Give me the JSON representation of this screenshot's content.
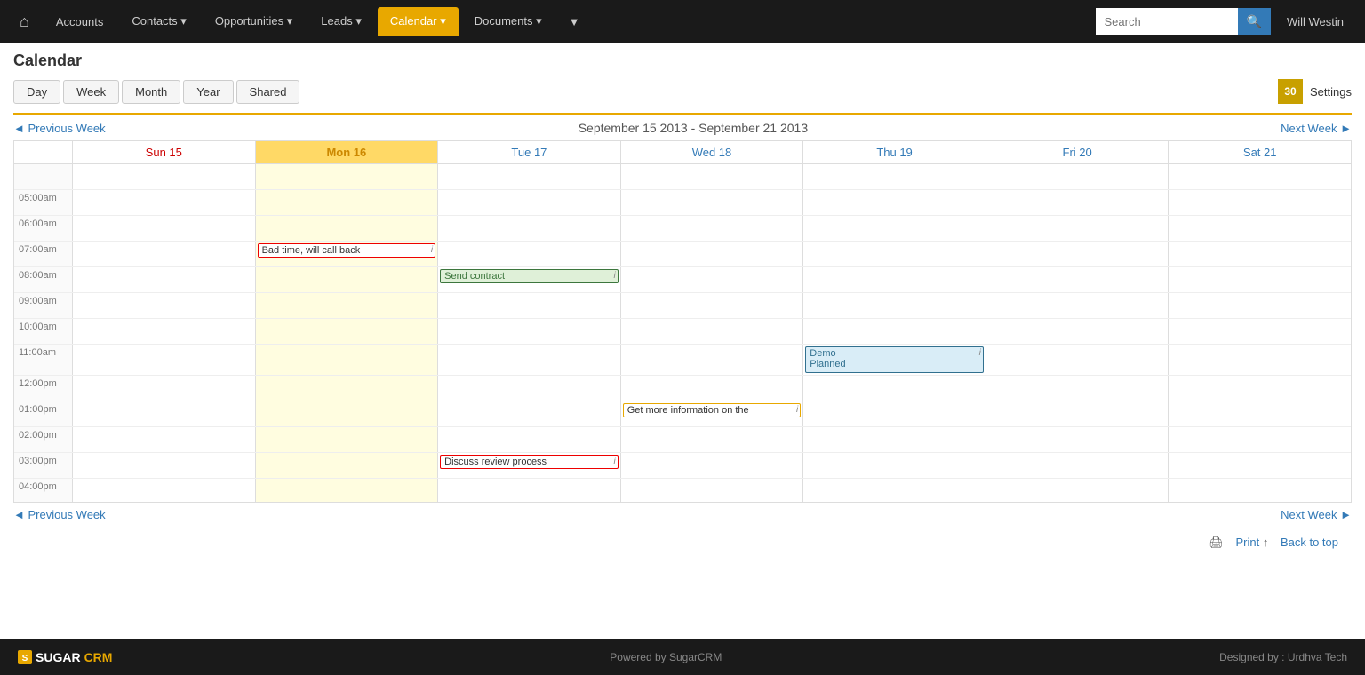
{
  "nav": {
    "home_icon": "⌂",
    "items": [
      {
        "label": "Accounts",
        "has_dropdown": true,
        "active": false
      },
      {
        "label": "Contacts",
        "has_dropdown": true,
        "active": false
      },
      {
        "label": "Opportunities",
        "has_dropdown": true,
        "active": false
      },
      {
        "label": "Leads",
        "has_dropdown": true,
        "active": false
      },
      {
        "label": "Calendar",
        "has_dropdown": true,
        "active": true
      },
      {
        "label": "Documents",
        "has_dropdown": true,
        "active": false
      }
    ],
    "extra_icon": "▼",
    "search_placeholder": "Search",
    "search_icon": "🔍",
    "user": "Will Westin",
    "user_dropdown": "▼"
  },
  "page": {
    "title": "Calendar",
    "view_tabs": [
      {
        "label": "Day",
        "active": false
      },
      {
        "label": "Week",
        "active": false
      },
      {
        "label": "Month",
        "active": false
      },
      {
        "label": "Year",
        "active": false
      },
      {
        "label": "Shared",
        "active": false
      }
    ],
    "calendar_icon_number": "30",
    "settings_label": "Settings"
  },
  "calendar": {
    "prev_week": "◄ Previous Week",
    "next_week": "Next Week ►",
    "week_title": "September 15 2013 - September 21 2013",
    "days": [
      {
        "label": "Sun 15",
        "day_class": "sunday"
      },
      {
        "label": "Mon 16",
        "day_class": "monday"
      },
      {
        "label": "Tue 17",
        "day_class": "tuesday"
      },
      {
        "label": "Wed 18",
        "day_class": "wednesday"
      },
      {
        "label": "Thu 19",
        "day_class": "thursday"
      },
      {
        "label": "Fri 20",
        "day_class": "friday"
      },
      {
        "label": "Sat 21",
        "day_class": "saturday"
      }
    ],
    "time_slots": [
      {
        "time": "",
        "events": [
          null,
          null,
          null,
          null,
          null,
          null,
          null
        ]
      },
      {
        "time": "05:00am",
        "events": [
          null,
          null,
          null,
          null,
          null,
          null,
          null
        ]
      },
      {
        "time": "06:00am",
        "events": [
          null,
          null,
          null,
          null,
          null,
          null,
          null
        ]
      },
      {
        "time": "07:00am",
        "events": [
          null,
          {
            "text": "Bad time, will call back",
            "type": "red"
          },
          null,
          null,
          null,
          null,
          null
        ]
      },
      {
        "time": "08:00am",
        "events": [
          null,
          null,
          {
            "text": "Send contract",
            "type": "green"
          },
          null,
          null,
          null,
          null
        ]
      },
      {
        "time": "09:00am",
        "events": [
          null,
          null,
          null,
          null,
          null,
          null,
          null
        ]
      },
      {
        "time": "10:00am",
        "events": [
          null,
          null,
          null,
          null,
          null,
          null,
          null
        ]
      },
      {
        "time": "11:00am",
        "events": [
          null,
          null,
          null,
          null,
          {
            "text": "Demo\nPlanned",
            "type": "blue"
          },
          null,
          null
        ]
      },
      {
        "time": "12:00pm",
        "events": [
          null,
          null,
          null,
          null,
          null,
          null,
          null
        ]
      },
      {
        "time": "01:00pm",
        "events": [
          null,
          null,
          null,
          {
            "text": "Get more information on the",
            "type": "orange"
          },
          null,
          null,
          null
        ]
      },
      {
        "time": "02:00pm",
        "events": [
          null,
          null,
          null,
          null,
          null,
          null,
          null
        ]
      },
      {
        "time": "03:00pm",
        "events": [
          null,
          null,
          {
            "text": "Discuss review process",
            "type": "red"
          },
          null,
          null,
          null,
          null
        ]
      },
      {
        "time": "04:00pm",
        "events": [
          null,
          null,
          null,
          null,
          null,
          null,
          null
        ]
      }
    ]
  },
  "footer": {
    "prev_week": "◄ Previous Week",
    "next_week": "Next Week ►",
    "print_label": "Print",
    "back_to_top": "Back to top",
    "powered_by": "Powered by SugarCRM",
    "designed_by": "Designed by : Urdhva Tech",
    "brand_sugar": "SUGAR",
    "brand_crm": "CRM"
  }
}
